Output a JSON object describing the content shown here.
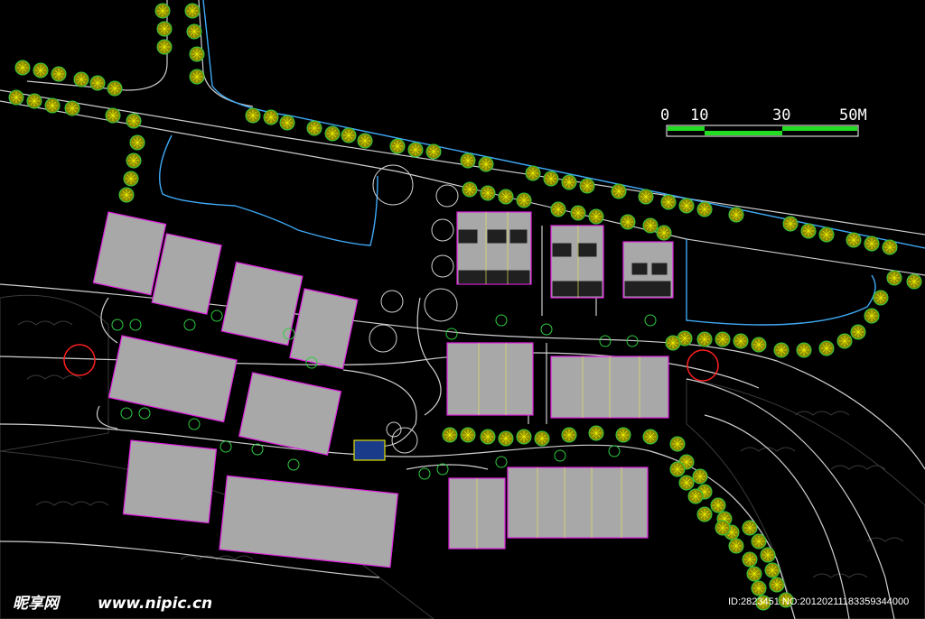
{
  "scale_bar": {
    "ticks": [
      "0",
      "10",
      "30",
      "50M"
    ],
    "colors": {
      "fill": "#22dd22",
      "frame": "#ffffff"
    }
  },
  "watermark": {
    "logo_text": "昵享网",
    "site": "www.nipic.cn",
    "id_line": "ID:2823451 NO:20120211183359344000"
  },
  "colors": {
    "background": "#000000",
    "road": "#cfcfcf",
    "water": "#3fa9f5",
    "building_fill": "#a8a8a8",
    "building_outline": "#e020e0",
    "tree_fill": "#c8c800",
    "tree_outline": "#2ecc40",
    "marker": "#ff2020",
    "vegetation": "#3a3a3a"
  },
  "markers": [
    "red-circle-west",
    "red-circle-east"
  ],
  "legend_icons": [
    "tree-icon",
    "building-icon",
    "road-icon",
    "pond-icon"
  ]
}
